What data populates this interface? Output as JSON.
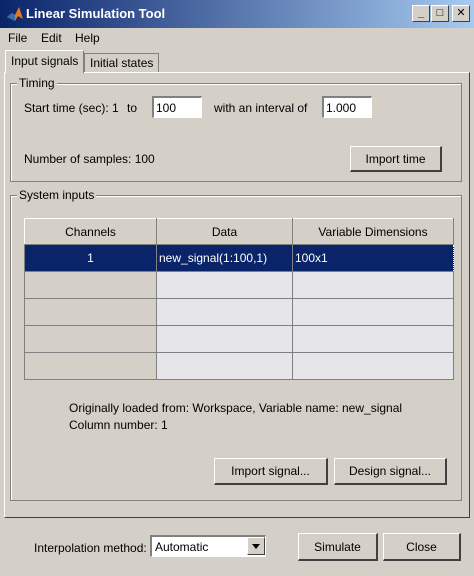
{
  "window": {
    "title": "Linear Simulation Tool",
    "minimize": "_",
    "maximize": "□",
    "close": "✕"
  },
  "menu": [
    "File",
    "Edit",
    "Help"
  ],
  "tabs": [
    {
      "label": "Input signals",
      "active": true
    },
    {
      "label": "Initial states",
      "active": false
    }
  ],
  "timing": {
    "group_label": "Timing",
    "start_label": "Start time (sec): 1",
    "to_label": "to",
    "end_value": "100",
    "interval_label": "with an interval of",
    "interval_value": "1.000",
    "samples_label": "Number of samples: 100",
    "import_time_button": "Import time"
  },
  "system_inputs": {
    "group_label": "System inputs",
    "columns": [
      "Channels",
      "Data",
      "Variable Dimensions"
    ],
    "rows": [
      {
        "channel": "1",
        "data": "new_signal(1:100,1)",
        "dims": "100x1",
        "selected": true
      },
      {
        "channel": "",
        "data": "",
        "dims": ""
      },
      {
        "channel": "",
        "data": "",
        "dims": ""
      },
      {
        "channel": "",
        "data": "",
        "dims": ""
      },
      {
        "channel": "",
        "data": "",
        "dims": ""
      }
    ],
    "loaded_from": "Originally loaded from:  Workspace, Variable name: new_signal",
    "column_number": "Column number:  1",
    "import_signal_button": "Import signal...",
    "design_signal_button": "Design signal..."
  },
  "footer": {
    "interpolation_label": "Interpolation method:",
    "interpolation_value": "Automatic",
    "simulate_button": "Simulate",
    "close_button": "Close"
  },
  "colors": {
    "title_bar": "#0a246a",
    "selection": "#0a246a",
    "face": "#d4d0c8"
  }
}
